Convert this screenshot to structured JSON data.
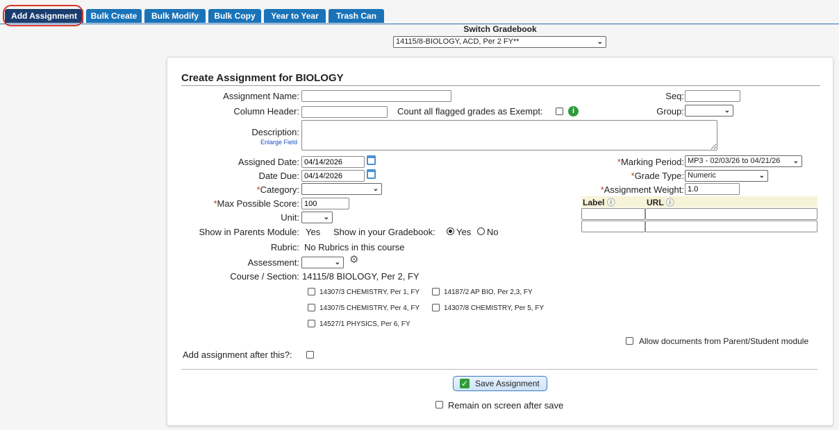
{
  "tabs": [
    "Add Assignment",
    "Bulk Create",
    "Bulk Modify",
    "Bulk Copy",
    "Year to Year",
    "Trash Can"
  ],
  "switch_gradebook": {
    "title": "Switch Gradebook",
    "value": "14115/8-BIOLOGY, ACD, Per 2 FY**"
  },
  "form": {
    "title": "Create Assignment for BIOLOGY",
    "assignment_name_label": "Assignment Name:",
    "column_header_label": "Column Header:",
    "count_flagged_label": "Count all flagged grades as Exempt:",
    "description_label": "Description:",
    "enlarge_field": "Enlarge Field",
    "seq_label": "Seq:",
    "group_label": "Group:",
    "assigned_date_label": "Assigned Date:",
    "assigned_date": "04/14/2026",
    "date_due_label": "Date Due:",
    "date_due": "04/14/2026",
    "category_label": "Category:",
    "max_score_label": "Max Possible Score:",
    "max_score": "100",
    "unit_label": "Unit:",
    "marking_period_label": "Marking Period:",
    "marking_period": "MP3 - 02/03/26 to 04/21/26",
    "grade_type_label": "Grade Type:",
    "grade_type": "Numeric",
    "weight_label": "Assignment Weight:",
    "weight": "1.0",
    "url_label_header": "Label",
    "url_header": "URL",
    "show_parents_label": "Show in Parents Module:",
    "show_parents_value": "Yes",
    "show_gradebook_label": "Show in your Gradebook:",
    "yes": "Yes",
    "no": "No",
    "rubric_label": "Rubric:",
    "rubric_value": "No Rubrics in this course",
    "assessment_label": "Assessment:",
    "course_section_label": "Course / Section:",
    "course_section_value": "14115/8 BIOLOGY, Per 2, FY",
    "sections": [
      "14307/3 CHEMISTRY, Per 1, FY",
      "14187/2 AP BIO, Per 2,3, FY",
      "14307/5 CHEMISTRY, Per 4, FY",
      "14307/8 CHEMISTRY, Per 5, FY",
      "14527/1 PHYSICS, Per 6, FY"
    ],
    "allow_docs_label": "Allow documents from Parent/Student module",
    "add_after_label": "Add assignment after this?:",
    "save_button": "Save Assignment",
    "remain_label": "Remain on screen after save"
  },
  "required_marker": "*",
  "colors": {
    "tab": "#1a73b8",
    "tab_active": "#1a3d6e",
    "ring": "#d9362b",
    "required": "#c0392b",
    "info_green": "#2e9c3a",
    "url_header_bg": "#f7f3d8"
  }
}
